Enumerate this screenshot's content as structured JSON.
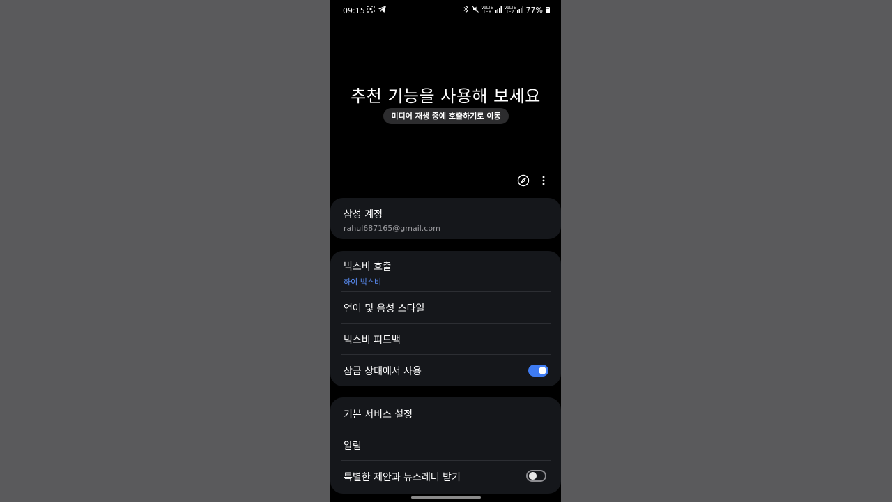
{
  "status_bar": {
    "time": "09:15",
    "left_icons": [
      "screenshot-icon",
      "telegram-icon"
    ],
    "right_icons": [
      "bluetooth-icon",
      "mute-icon",
      "volte-lte1-icon",
      "signal1-icon",
      "volte-lte2-icon",
      "signal2-icon"
    ],
    "network_labels": [
      "VoLTE LTE+",
      "VoLTE LTE2"
    ],
    "battery": "77%"
  },
  "hero": {
    "title": "추천 기능을 사용해 보세요",
    "chip": "미디어 재생 중에 호출하기로 이동"
  },
  "toolbar": {
    "icons": [
      "compass-icon",
      "more-vert-icon"
    ]
  },
  "account": {
    "title": "삼성 계정",
    "email": "rahul687165@gmail.com"
  },
  "bixby_group": {
    "wake": {
      "title": "빅스비 호출",
      "value": "하이 빅스비"
    },
    "language": {
      "title": "언어 및 음성 스타일"
    },
    "feedback": {
      "title": "빅스비 피드백"
    },
    "locked": {
      "title": "잠금 상태에서 사용",
      "enabled": true
    }
  },
  "services_group": {
    "basic": {
      "title": "기본 서비스 설정"
    },
    "notifications": {
      "title": "알림"
    },
    "newsletter": {
      "title": "특별한 제안과 뉴스레터 받기",
      "enabled": false
    }
  },
  "colors": {
    "accent": "#3e7bf2",
    "sub_blue": "#5b8ff9",
    "card_bg": "#15171b",
    "background": "#000000"
  }
}
